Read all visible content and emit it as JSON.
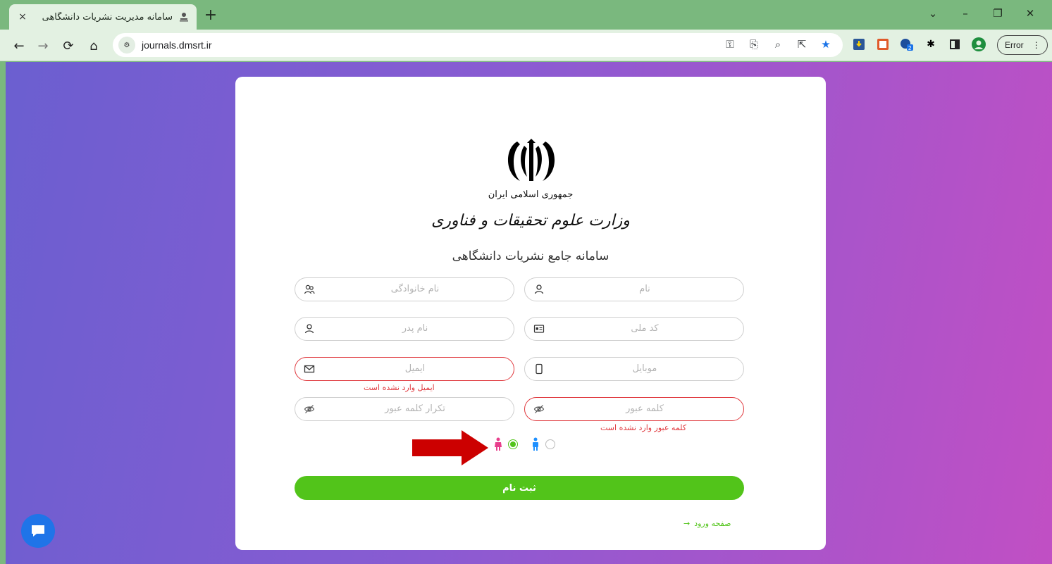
{
  "browser": {
    "tab_title": "سامانه مدیریت نشریات دانشگاهی",
    "tab_close": "×",
    "new_tab": "+",
    "url": "journals.dmsrt.ir",
    "error_chip": "Error"
  },
  "logo": {
    "line1": "جمهوری اسلامی ایران",
    "line2": "وزارت علوم تحقیقات و فناوری"
  },
  "form": {
    "title": "سامانه جامع نشریات دانشگاهی",
    "first_name_placeholder": "نام",
    "last_name_placeholder": "نام خانوادگی",
    "national_code_placeholder": "کد ملی",
    "father_name_placeholder": "نام پدر",
    "mobile_placeholder": "موبایل",
    "email_placeholder": "ایمیل",
    "email_error": "ایمیل وارد نشده است",
    "password_placeholder": "کلمه عبور",
    "password_error": "کلمه عبور وارد نشده است",
    "password_repeat_placeholder": "تکرار کلمه عبور",
    "gender_selected": "female",
    "submit_label": "ثبت نام",
    "login_link": "صفحه ورود"
  },
  "colors": {
    "accent_green": "#52c41a",
    "error_red": "#e0393e",
    "arrow_red": "#cc0000",
    "female_pink": "#e83e8c",
    "male_blue": "#1e90ff",
    "chat_blue": "#1f74e8"
  }
}
